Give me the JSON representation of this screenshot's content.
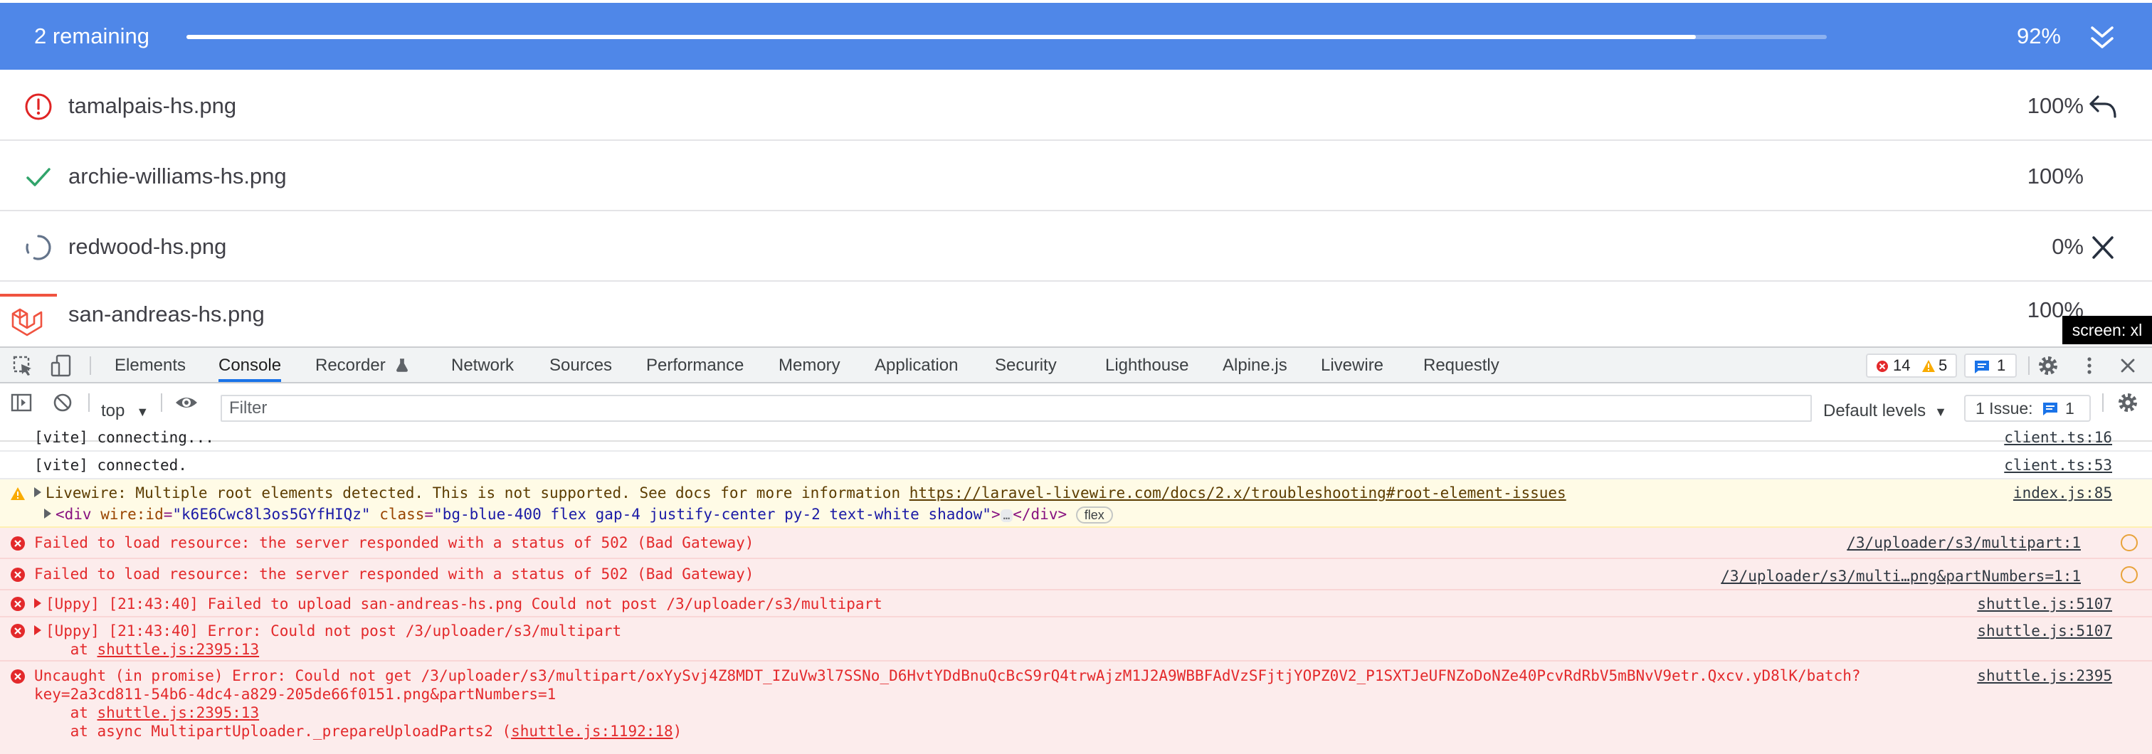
{
  "uploader": {
    "remaining_label": "2 remaining",
    "overall_percent": 92,
    "overall_percent_label": "92%",
    "accent_color": "#4f87e8",
    "files": [
      {
        "name": "tamalpais-hs.png",
        "percent_label": "100%",
        "status": "error",
        "status_icon": "error-circle-icon",
        "action_icon": "retry-icon"
      },
      {
        "name": "archie-williams-hs.png",
        "percent_label": "100%",
        "status": "complete",
        "status_icon": "checkmark-icon"
      },
      {
        "name": "redwood-hs.png",
        "percent_label": "0%",
        "status": "uploading",
        "status_icon": "spinner-icon",
        "action_icon": "close-icon"
      },
      {
        "name": "san-andreas-hs.png",
        "percent_label": "100%",
        "status": "partial"
      }
    ]
  },
  "screen_badge": "screen: xl",
  "devtools": {
    "tabs": [
      "Elements",
      "Console",
      "Recorder",
      "Network",
      "Sources",
      "Performance",
      "Memory",
      "Application",
      "Security",
      "Lighthouse",
      "Alpine.js",
      "Livewire",
      "Requestly"
    ],
    "active_tab": "Console",
    "error_count": "14",
    "warning_count": "5",
    "message_count": "1",
    "context": "top",
    "filter_placeholder": "Filter",
    "levels_label": "Default levels",
    "issues_label": "1 Issue:",
    "issues_count": "1"
  },
  "console": {
    "msg1": {
      "text": "[vite] connecting...",
      "source": "client.ts:16"
    },
    "msg2": {
      "text": "[vite] connected.",
      "source": "client.ts:53"
    },
    "msg3": {
      "text": "Livewire: Multiple root elements detected. This is not supported. See docs for more information ",
      "link": "https://laravel-livewire.com/docs/2.x/troubleshooting#root-element-issues",
      "source": "index.js:85",
      "dom_open": "<div ",
      "dom_attr1": "wire:id",
      "dom_val1": "\"k6E6Cwc8l3os5GYfHIQz\"",
      "dom_attr2": "class",
      "dom_val2": "\"bg-blue-400 flex gap-4 justify-center py-2 text-white shadow\"",
      "dom_mid": ">",
      "ellipsis": "…",
      "dom_close": "</div>",
      "pill": "flex"
    },
    "msg4": {
      "text": "Failed to load resource: the server responded with a status of 502 (Bad Gateway)",
      "source": "/3/uploader/s3/multipart:1"
    },
    "msg5": {
      "text": "Failed to load resource: the server responded with a status of 502 (Bad Gateway)",
      "source": "/3/uploader/s3/multi…png&partNumbers=1:1"
    },
    "msg6": {
      "text": "[Uppy] [21:43:40] Failed to upload san-andreas-hs.png Could not post /3/uploader/s3/multipart",
      "source": "shuttle.js:5107"
    },
    "msg7": {
      "text": "[Uppy] [21:43:40] Error: Could not post /3/uploader/s3/multipart",
      "at_prefix": "    at ",
      "at_link": "shuttle.js:2395:13",
      "source": "shuttle.js:5107"
    },
    "msg8": {
      "line1": "Uncaught (in promise) Error: Could not get /3/uploader/s3/multipart/oxYySvj4Z8MDT_IZuVw3l7SSNo_D6HvtYDdBnuQcBcS9rQ4trwAjzM1J2A9WBBFAdVzSFjtjYOPZ0V2_P1SXTJeUFNZoDoNZe40PcvRdRbV5mBNvV9etr.Qxcv.yD8lK/batch?",
      "line2": "key=2a3cd811-54b6-4dc4-a829-205de66f0151.png&partNumbers=1",
      "at1_prefix": "    at ",
      "at1_link": "shuttle.js:2395:13",
      "at2_prefix": "    at async MultipartUploader._prepareUploadParts2 (",
      "at2_link": "shuttle.js:1192:18",
      "at2_suffix": ")",
      "source": "shuttle.js:2395"
    }
  }
}
